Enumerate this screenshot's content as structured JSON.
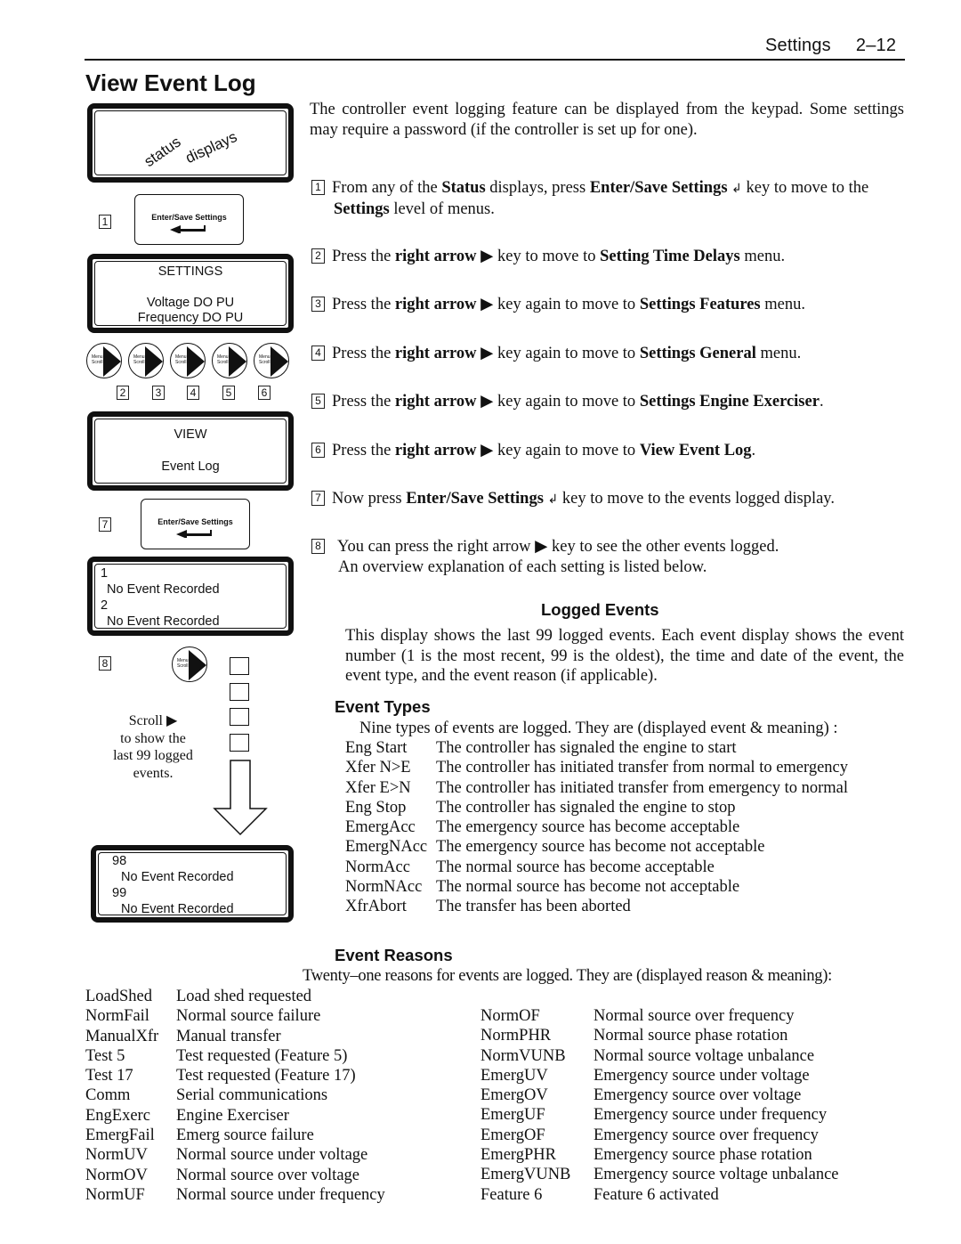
{
  "header": {
    "section": "Settings",
    "page_number": "2–12"
  },
  "title": "View Event Log",
  "diagram": {
    "status_display": {
      "word1": "status",
      "word2": "displays"
    },
    "enter_key_label": "Enter/Save Settings",
    "settings_display": {
      "line1": "SETTINGS",
      "line2": "Voltage DO PU",
      "line3": "Frequency DO PU"
    },
    "menu_button": {
      "line1": "Menu",
      "line2": "Scroll"
    },
    "step_numbers": [
      "1",
      "2",
      "3",
      "4",
      "5",
      "6",
      "7",
      "8"
    ],
    "view_display": {
      "line1": "VIEW",
      "line2": "Event Log"
    },
    "event_display_first": {
      "num1": "1",
      "text1": "No Event Recorded",
      "num2": "2",
      "text2": "No Event Recorded"
    },
    "event_display_last": {
      "num1": "98",
      "text1": "No Event Recorded",
      "num2": "99",
      "text2": "No Event Recorded"
    },
    "scroll_caption": {
      "line1": "Scroll ▶",
      "line2": "to show the",
      "line3": "last 99 logged",
      "line4": "events."
    }
  },
  "intro": "The controller event logging feature can be displayed from the keypad. Some settings may require a password (if the controller is set up for one).",
  "steps": [
    {
      "num": "1",
      "parts": [
        "From any of the ",
        "Status",
        " displays, press ",
        "Enter/Save Settings",
        " key to move to the ",
        "Settings",
        " level of menus."
      ]
    },
    {
      "num": "2",
      "parts": [
        "Press the ",
        "right arrow",
        " key to move to ",
        "Setting Time Delays",
        " menu."
      ]
    },
    {
      "num": "3",
      "parts": [
        "Press the ",
        "right arrow",
        " key again to move to ",
        "Settings Features",
        " menu."
      ]
    },
    {
      "num": "4",
      "parts": [
        "Press the ",
        "right arrow",
        " key again to move to ",
        "Settings General",
        " menu."
      ]
    },
    {
      "num": "5",
      "parts": [
        "Press the ",
        "right arrow",
        " key again to move to ",
        "Settings Engine Exerciser",
        "."
      ]
    },
    {
      "num": "6",
      "parts": [
        "Press the ",
        "right arrow",
        " key again to move to ",
        "View Event Log",
        "."
      ]
    },
    {
      "num": "7",
      "parts": [
        "Now press ",
        "Enter/Save Settings",
        " key to move to the events logged display."
      ]
    },
    {
      "num": "8",
      "parts": [
        "You can press the right arrow",
        " key to see the other events logged.",
        "An overview explanation of each setting is listed below."
      ]
    }
  ],
  "logged_events": {
    "heading": "Logged Events",
    "text": "This display shows the last 99 logged events.  Each event display shows the event number (1 is the most recent, 99 is the oldest), the time and date of the event, the event type, and the event reason (if applicable)."
  },
  "event_types": {
    "heading": "Event Types",
    "intro": "Nine types of events are logged.  They are (displayed event & meaning) :",
    "rows": [
      {
        "code": "Eng Start",
        "meaning": "The controller has signaled the engine to start"
      },
      {
        "code": "Xfer N>E",
        "meaning": "The controller has initiated transfer from normal to emergency"
      },
      {
        "code": "Xfer E>N",
        "meaning": "The controller has initiated transfer from emergency to normal"
      },
      {
        "code": "Eng Stop",
        "meaning": "The controller has signaled the engine to stop"
      },
      {
        "code": "EmergAcc",
        "meaning": "The emergency source has become acceptable"
      },
      {
        "code": "EmergNAcc",
        "meaning": "The emergency source has become not acceptable"
      },
      {
        "code": "NormAcc",
        "meaning": "The normal source has become acceptable"
      },
      {
        "code": "NormNAcc",
        "meaning": "The normal source has become not acceptable"
      },
      {
        "code": "XfrAbort",
        "meaning": "The transfer has been aborted"
      }
    ]
  },
  "event_reasons": {
    "heading": "Event Reasons",
    "intro": "Twenty–one reasons for events are logged.  They are (displayed reason & meaning):",
    "left": [
      {
        "code": "LoadShed",
        "meaning": "Load shed requested"
      },
      {
        "code": "NormFail",
        "meaning": "Normal source failure"
      },
      {
        "code": "ManualXfr",
        "meaning": "Manual transfer"
      },
      {
        "code": "Test 5",
        "meaning": "Test requested (Feature 5)"
      },
      {
        "code": "Test 17",
        "meaning": "Test requested (Feature 17)"
      },
      {
        "code": "Comm",
        "meaning": "Serial communications"
      },
      {
        "code": "EngExerc",
        "meaning": "Engine Exerciser"
      },
      {
        "code": "EmergFail",
        "meaning": "Emerg source failure"
      },
      {
        "code": "NormUV",
        "meaning": "Normal source under voltage"
      },
      {
        "code": "NormOV",
        "meaning": "Normal source over voltage"
      },
      {
        "code": "NormUF",
        "meaning": "Normal source under frequency"
      }
    ],
    "right": [
      {
        "code": "NormOF",
        "meaning": "Normal source over frequency"
      },
      {
        "code": "NormPHR",
        "meaning": "Normal source phase rotation"
      },
      {
        "code": "NormVUNB",
        "meaning": "Normal source voltage unbalance"
      },
      {
        "code": "EmergUV",
        "meaning": "Emergency source under voltage"
      },
      {
        "code": "EmergOV",
        "meaning": "Emergency source over voltage"
      },
      {
        "code": "EmergUF",
        "meaning": "Emergency source under frequency"
      },
      {
        "code": "EmergOF",
        "meaning": "Emergency source over frequency"
      },
      {
        "code": "EmergPHR",
        "meaning": "Emergency source phase rotation"
      },
      {
        "code": "EmergVUNB",
        "meaning": "Emergency source voltage unbalance"
      },
      {
        "code": "Feature 6",
        "meaning": "Feature 6 activated"
      }
    ]
  }
}
